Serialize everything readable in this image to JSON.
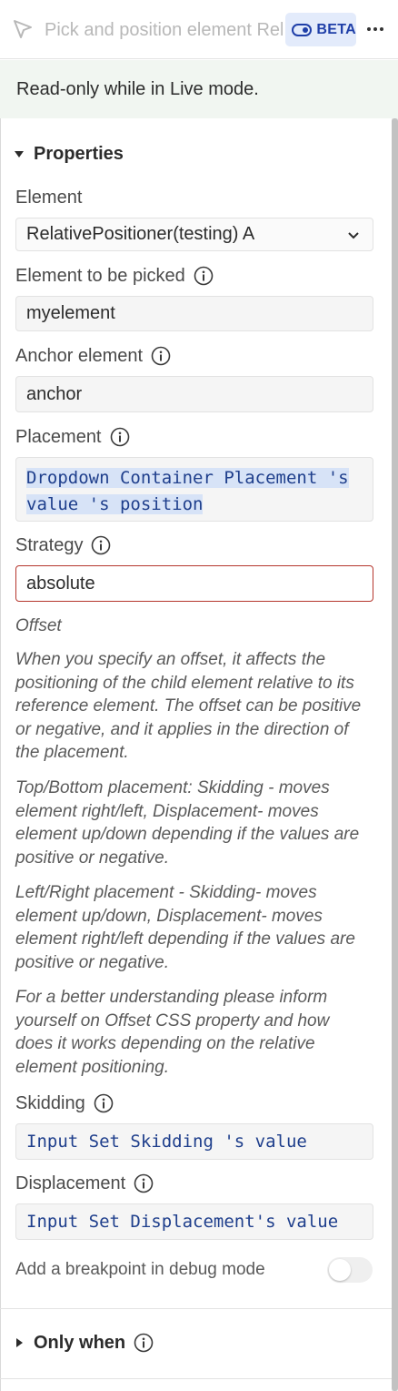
{
  "header": {
    "title": "Pick and position element RelativePositioner",
    "beta_label": "BETA",
    "icons": [
      "cursor-icon",
      "toggle-icon",
      "more-icon"
    ]
  },
  "notice": "Read-only while in Live mode.",
  "properties": {
    "section_title": "Properties",
    "element": {
      "label": "Element",
      "value": "RelativePositioner(testing) A"
    },
    "element_to_pick": {
      "label": "Element to be picked",
      "value": "myelement"
    },
    "anchor": {
      "label": "Anchor element",
      "value": "anchor"
    },
    "placement": {
      "label": "Placement",
      "line1": "Dropdown Container Placement 's",
      "line2": "value 's position"
    },
    "strategy": {
      "label": "Strategy",
      "value": "absolute"
    },
    "offset": {
      "label": "Offset",
      "paragraphs": [
        "When you specify an offset, it affects the positioning of the child element relative to its reference element. The offset can be positive or negative, and it applies in the direction of the placement.",
        "Top/Bottom placement: Skidding - moves element right/left, Displacement- moves element up/down depending if the values are positive or negative.",
        "Left/Right placement - Skidding- moves element up/down, Displacement- moves element right/left depending if the values are positive or negative.",
        "For a better understanding please inform yourself on Offset CSS property and how does it works depending on the relative element positioning."
      ]
    },
    "skidding": {
      "label": "Skidding",
      "value": "Input Set Skidding 's value"
    },
    "displacement": {
      "label": "Displacement",
      "value": "Input Set Displacement's value"
    },
    "breakpoint": {
      "label": "Add a breakpoint in debug mode",
      "enabled": false
    }
  },
  "only_when": {
    "section_title": "Only when"
  },
  "colors": {
    "accent": "#1f3fa8",
    "expression_text": "#1f3f8c",
    "error_border": "#b5362d",
    "notice_bg": "#f1f6f1"
  }
}
